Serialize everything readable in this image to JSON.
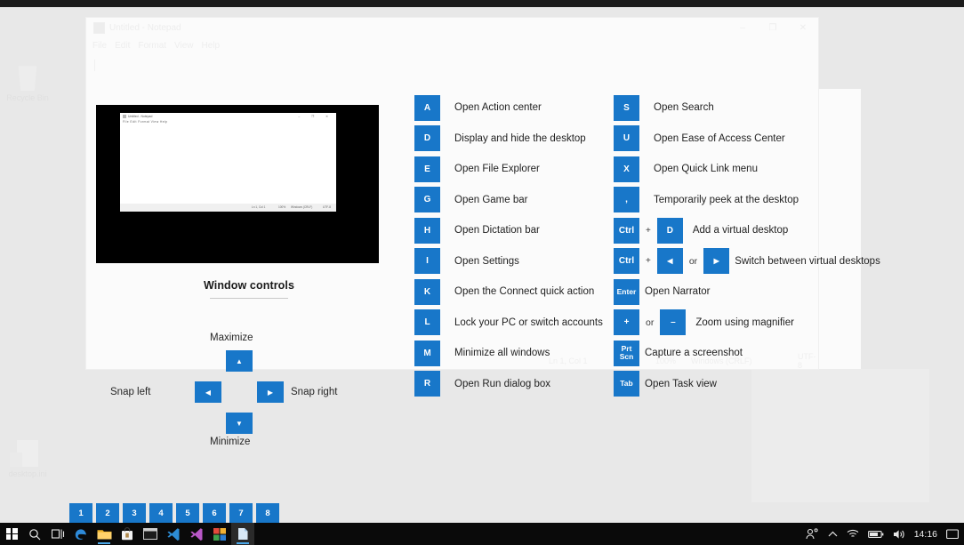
{
  "desktop": {
    "icons": [
      {
        "name": "Recycle Bin",
        "icon": "recycle-bin-icon"
      },
      {
        "name": "desktop.ini",
        "icon": "file-icon"
      }
    ]
  },
  "notepad": {
    "title": "Untitled - Notepad",
    "icon": "notepad-icon",
    "menu": [
      "File",
      "Edit",
      "Format",
      "View",
      "Help"
    ],
    "controls": {
      "minimize": "–",
      "maximize": "❐",
      "close": "✕"
    },
    "status": {
      "position": "Ln 1, Col 1",
      "zoom": "100%",
      "line_ending": "Windows (CRLF)",
      "encoding": "UTF-8"
    }
  },
  "video_panel": {
    "mini_window": {
      "title": "Untitled - Notepad",
      "menu": "File  Edit  Format  View  Help",
      "controls": "–  ❐  ✕",
      "status": {
        "position": "Ln 1, Col 1",
        "zoom": "100%",
        "line_ending": "Windows (CRLF)",
        "encoding": "UTF-8"
      }
    }
  },
  "window_controls": {
    "title": "Window controls",
    "maximize_label": "Maximize",
    "minimize_label": "Minimize",
    "snap_left_label": "Snap left",
    "snap_right_label": "Snap right",
    "up_key": "▲",
    "down_key": "▼",
    "left_key": "◀",
    "right_key": "▶"
  },
  "shortcuts": {
    "left_column": [
      {
        "keys": [
          "A"
        ],
        "description": "Open Action center"
      },
      {
        "keys": [
          "D"
        ],
        "description": "Display and hide the desktop"
      },
      {
        "keys": [
          "E"
        ],
        "description": "Open File Explorer"
      },
      {
        "keys": [
          "G"
        ],
        "description": "Open Game bar"
      },
      {
        "keys": [
          "H"
        ],
        "description": "Open Dictation bar"
      },
      {
        "keys": [
          "I"
        ],
        "description": "Open Settings"
      },
      {
        "keys": [
          "K"
        ],
        "description": "Open the Connect quick action"
      },
      {
        "keys": [
          "L"
        ],
        "description": "Lock your PC or switch accounts"
      },
      {
        "keys": [
          "M"
        ],
        "description": "Minimize all windows"
      },
      {
        "keys": [
          "R"
        ],
        "description": "Open Run dialog box"
      }
    ],
    "right_column": [
      {
        "keys": [
          "S"
        ],
        "description": "Open Search"
      },
      {
        "keys": [
          "U"
        ],
        "description": "Open Ease of Access Center"
      },
      {
        "keys": [
          "X"
        ],
        "description": "Open Quick Link menu"
      },
      {
        "keys": [
          ","
        ],
        "description": "Temporarily peek at the desktop"
      },
      {
        "keys": [
          "Ctrl",
          "D"
        ],
        "joiner": "+",
        "description": "Add a virtual desktop"
      },
      {
        "keys": [
          "Ctrl",
          "◀",
          "▶"
        ],
        "joiner": "+",
        "joiner2": "or",
        "description": "Switch between virtual desktops"
      },
      {
        "keys": [
          "Enter"
        ],
        "description": "Open Narrator"
      },
      {
        "keys": [
          "+",
          "–"
        ],
        "joiner2": "or",
        "description": "Zoom using magnifier"
      },
      {
        "keys": [
          "Prt\nScn"
        ],
        "description": "Capture a screenshot"
      },
      {
        "keys": [
          "Tab"
        ],
        "description": "Open Task view"
      }
    ]
  },
  "badges": [
    "1",
    "2",
    "3",
    "4",
    "5",
    "6",
    "7",
    "8"
  ],
  "taskbar": {
    "items": [
      {
        "name": "start-button",
        "icon": "windows-logo-icon"
      },
      {
        "name": "search-button",
        "icon": "search-icon"
      },
      {
        "name": "task-view-button",
        "icon": "task-view-icon"
      },
      {
        "name": "edge-button",
        "icon": "edge-icon"
      },
      {
        "name": "file-explorer-button",
        "icon": "folder-icon"
      },
      {
        "name": "store-button",
        "icon": "store-bag-icon"
      },
      {
        "name": "terminal-button",
        "icon": "terminal-icon"
      },
      {
        "name": "vscode-button",
        "icon": "vscode-icon"
      },
      {
        "name": "vscode-insiders-button",
        "icon": "vscode-insiders-icon"
      },
      {
        "name": "colorgrid-button",
        "icon": "color-grid-icon"
      },
      {
        "name": "notepad-button",
        "icon": "notepad-taskbar-icon"
      }
    ],
    "tray": [
      {
        "name": "people-icon",
        "icon": "people-icon"
      },
      {
        "name": "show-hidden-icons",
        "icon": "chevron-up-icon"
      },
      {
        "name": "network-icon",
        "icon": "wifi-icon"
      },
      {
        "name": "battery-icon",
        "icon": "battery-icon"
      },
      {
        "name": "volume-icon",
        "icon": "speaker-icon"
      }
    ],
    "clock": "14:16",
    "notification_icon": "notification-icon"
  },
  "colors": {
    "accent": "#1877c9",
    "taskbar": "#0a0a0a",
    "desktop": "#e8e8e8",
    "video_panel": "#000000",
    "text": "#1f1f1f"
  }
}
